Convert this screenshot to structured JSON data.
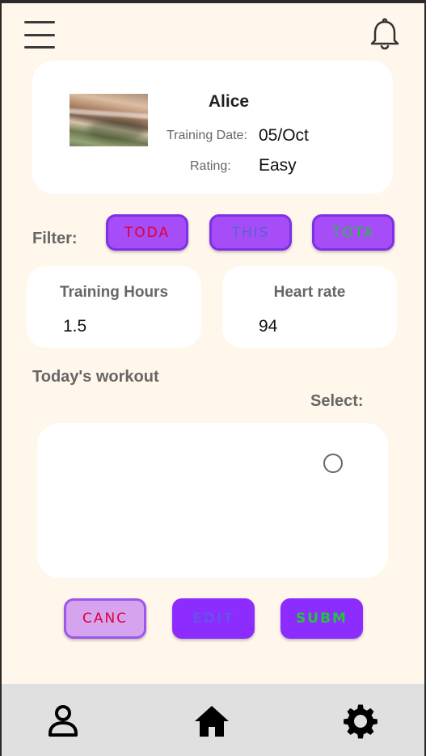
{
  "header": {
    "menu_icon": "hamburger-menu-icon",
    "notification_icon": "bell-icon"
  },
  "profile": {
    "name": "Alice",
    "training_date_label": "Training Date:",
    "training_date_value": "05/Oct",
    "rating_label": "Rating:",
    "rating_value": "Easy"
  },
  "filter": {
    "label": "Filter:",
    "buttons": [
      "TODA",
      "THIS",
      "TOTA"
    ],
    "colors": {
      "button_bg": "#a64df8",
      "button_border": "#7d31e6",
      "today_text": "#e00032",
      "this_text": "#5564cf",
      "total_text": "#1fc238"
    }
  },
  "metrics": {
    "training_hours": {
      "label": "Training Hours",
      "value": "1.5"
    },
    "heart_rate": {
      "label": "Heart rate",
      "value": "94"
    }
  },
  "workout": {
    "title": "Today's workout",
    "select_label": "Select:"
  },
  "actions": {
    "cancel": "CANC",
    "edit": "EDIT",
    "submit": "SUBM",
    "colors": {
      "cancel_bg": "#d6a4ef",
      "primary_bg": "#8c2cff",
      "cancel_text": "#dd003b",
      "edit_text": "#6950ee",
      "submit_text": "#23c53b"
    }
  },
  "bottom_nav": {
    "items": [
      "profile-icon",
      "home-icon",
      "settings-icon"
    ]
  },
  "theme": {
    "page_bg": "#fff6ec",
    "card_bg": "#ffffff",
    "nav_bg": "#e0e0e0"
  }
}
